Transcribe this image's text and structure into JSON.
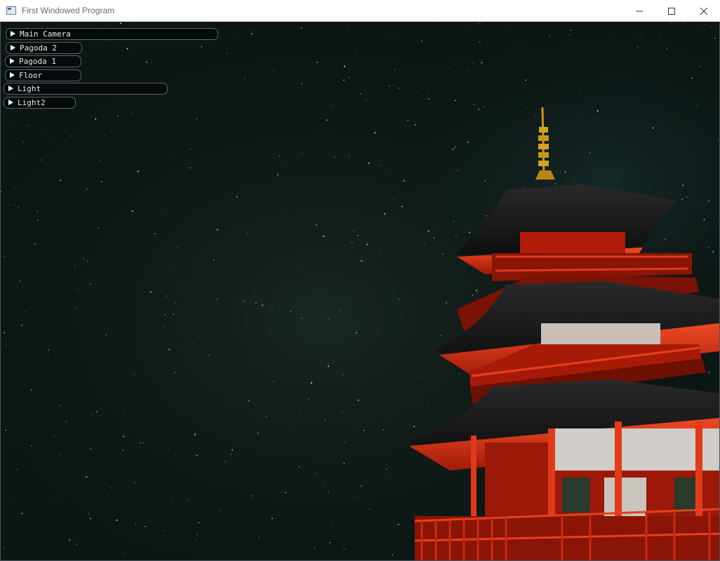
{
  "window": {
    "title": "First Windowed Program",
    "icon": "app-window-icon",
    "controls": [
      "minimize-icon",
      "maximize-icon",
      "close-icon"
    ]
  },
  "scene": {
    "sky_color": "#0c1614",
    "pagoda_red": "#c8200a",
    "roof_color": "#1c1c1c",
    "spire_color": "#d4a21e"
  },
  "panels": [
    {
      "label": "Main Camera",
      "expanded": false
    },
    {
      "label": "Pagoda 2",
      "expanded": false
    },
    {
      "label": "Pagoda 1",
      "expanded": false
    },
    {
      "label": "Floor",
      "expanded": false
    },
    {
      "label": "Light",
      "expanded": false
    },
    {
      "label": "Light2",
      "expanded": false
    }
  ]
}
